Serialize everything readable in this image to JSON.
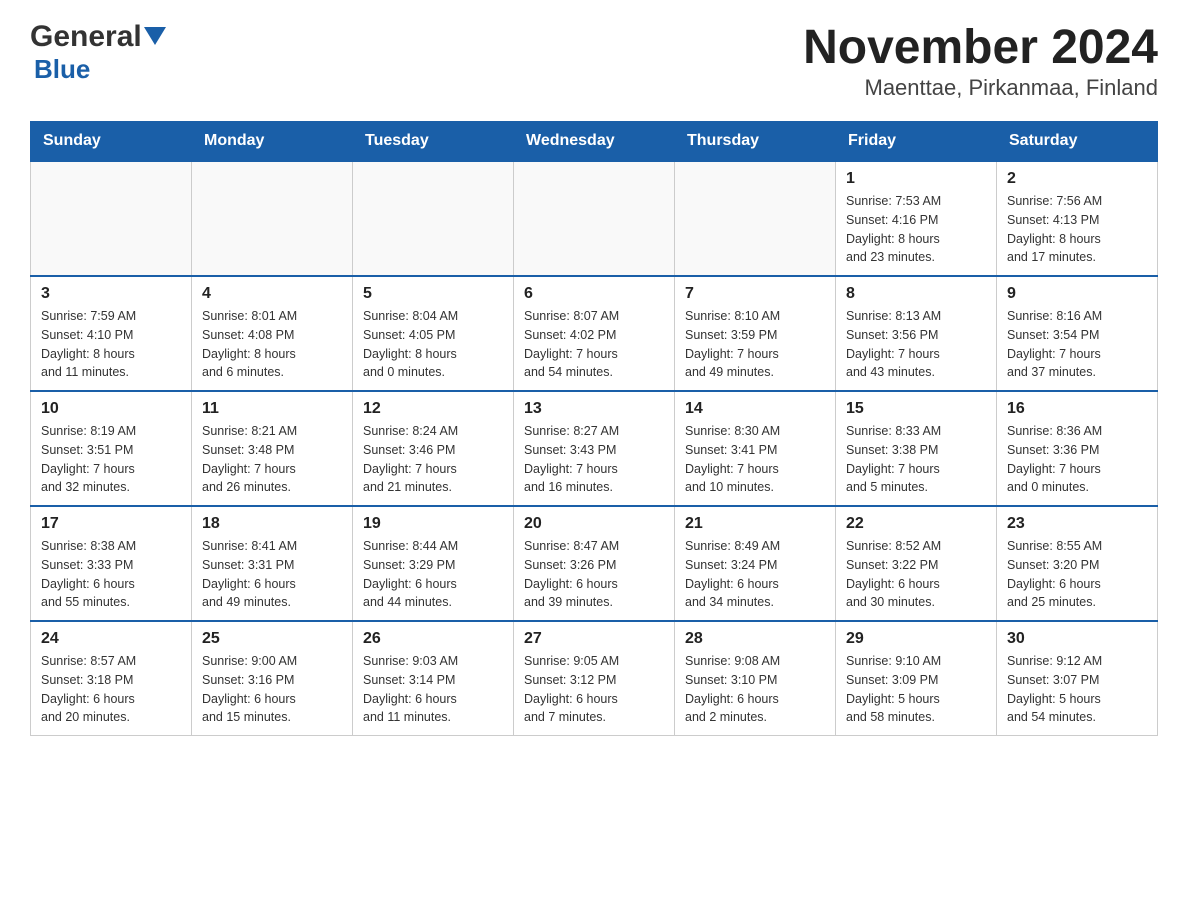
{
  "header": {
    "logo_general": "General",
    "logo_blue": "Blue",
    "title": "November 2024",
    "subtitle": "Maenttae, Pirkanmaa, Finland"
  },
  "calendar": {
    "days_of_week": [
      "Sunday",
      "Monday",
      "Tuesday",
      "Wednesday",
      "Thursday",
      "Friday",
      "Saturday"
    ],
    "weeks": [
      [
        {
          "day": "",
          "info": ""
        },
        {
          "day": "",
          "info": ""
        },
        {
          "day": "",
          "info": ""
        },
        {
          "day": "",
          "info": ""
        },
        {
          "day": "",
          "info": ""
        },
        {
          "day": "1",
          "info": "Sunrise: 7:53 AM\nSunset: 4:16 PM\nDaylight: 8 hours\nand 23 minutes."
        },
        {
          "day": "2",
          "info": "Sunrise: 7:56 AM\nSunset: 4:13 PM\nDaylight: 8 hours\nand 17 minutes."
        }
      ],
      [
        {
          "day": "3",
          "info": "Sunrise: 7:59 AM\nSunset: 4:10 PM\nDaylight: 8 hours\nand 11 minutes."
        },
        {
          "day": "4",
          "info": "Sunrise: 8:01 AM\nSunset: 4:08 PM\nDaylight: 8 hours\nand 6 minutes."
        },
        {
          "day": "5",
          "info": "Sunrise: 8:04 AM\nSunset: 4:05 PM\nDaylight: 8 hours\nand 0 minutes."
        },
        {
          "day": "6",
          "info": "Sunrise: 8:07 AM\nSunset: 4:02 PM\nDaylight: 7 hours\nand 54 minutes."
        },
        {
          "day": "7",
          "info": "Sunrise: 8:10 AM\nSunset: 3:59 PM\nDaylight: 7 hours\nand 49 minutes."
        },
        {
          "day": "8",
          "info": "Sunrise: 8:13 AM\nSunset: 3:56 PM\nDaylight: 7 hours\nand 43 minutes."
        },
        {
          "day": "9",
          "info": "Sunrise: 8:16 AM\nSunset: 3:54 PM\nDaylight: 7 hours\nand 37 minutes."
        }
      ],
      [
        {
          "day": "10",
          "info": "Sunrise: 8:19 AM\nSunset: 3:51 PM\nDaylight: 7 hours\nand 32 minutes."
        },
        {
          "day": "11",
          "info": "Sunrise: 8:21 AM\nSunset: 3:48 PM\nDaylight: 7 hours\nand 26 minutes."
        },
        {
          "day": "12",
          "info": "Sunrise: 8:24 AM\nSunset: 3:46 PM\nDaylight: 7 hours\nand 21 minutes."
        },
        {
          "day": "13",
          "info": "Sunrise: 8:27 AM\nSunset: 3:43 PM\nDaylight: 7 hours\nand 16 minutes."
        },
        {
          "day": "14",
          "info": "Sunrise: 8:30 AM\nSunset: 3:41 PM\nDaylight: 7 hours\nand 10 minutes."
        },
        {
          "day": "15",
          "info": "Sunrise: 8:33 AM\nSunset: 3:38 PM\nDaylight: 7 hours\nand 5 minutes."
        },
        {
          "day": "16",
          "info": "Sunrise: 8:36 AM\nSunset: 3:36 PM\nDaylight: 7 hours\nand 0 minutes."
        }
      ],
      [
        {
          "day": "17",
          "info": "Sunrise: 8:38 AM\nSunset: 3:33 PM\nDaylight: 6 hours\nand 55 minutes."
        },
        {
          "day": "18",
          "info": "Sunrise: 8:41 AM\nSunset: 3:31 PM\nDaylight: 6 hours\nand 49 minutes."
        },
        {
          "day": "19",
          "info": "Sunrise: 8:44 AM\nSunset: 3:29 PM\nDaylight: 6 hours\nand 44 minutes."
        },
        {
          "day": "20",
          "info": "Sunrise: 8:47 AM\nSunset: 3:26 PM\nDaylight: 6 hours\nand 39 minutes."
        },
        {
          "day": "21",
          "info": "Sunrise: 8:49 AM\nSunset: 3:24 PM\nDaylight: 6 hours\nand 34 minutes."
        },
        {
          "day": "22",
          "info": "Sunrise: 8:52 AM\nSunset: 3:22 PM\nDaylight: 6 hours\nand 30 minutes."
        },
        {
          "day": "23",
          "info": "Sunrise: 8:55 AM\nSunset: 3:20 PM\nDaylight: 6 hours\nand 25 minutes."
        }
      ],
      [
        {
          "day": "24",
          "info": "Sunrise: 8:57 AM\nSunset: 3:18 PM\nDaylight: 6 hours\nand 20 minutes."
        },
        {
          "day": "25",
          "info": "Sunrise: 9:00 AM\nSunset: 3:16 PM\nDaylight: 6 hours\nand 15 minutes."
        },
        {
          "day": "26",
          "info": "Sunrise: 9:03 AM\nSunset: 3:14 PM\nDaylight: 6 hours\nand 11 minutes."
        },
        {
          "day": "27",
          "info": "Sunrise: 9:05 AM\nSunset: 3:12 PM\nDaylight: 6 hours\nand 7 minutes."
        },
        {
          "day": "28",
          "info": "Sunrise: 9:08 AM\nSunset: 3:10 PM\nDaylight: 6 hours\nand 2 minutes."
        },
        {
          "day": "29",
          "info": "Sunrise: 9:10 AM\nSunset: 3:09 PM\nDaylight: 5 hours\nand 58 minutes."
        },
        {
          "day": "30",
          "info": "Sunrise: 9:12 AM\nSunset: 3:07 PM\nDaylight: 5 hours\nand 54 minutes."
        }
      ]
    ]
  }
}
